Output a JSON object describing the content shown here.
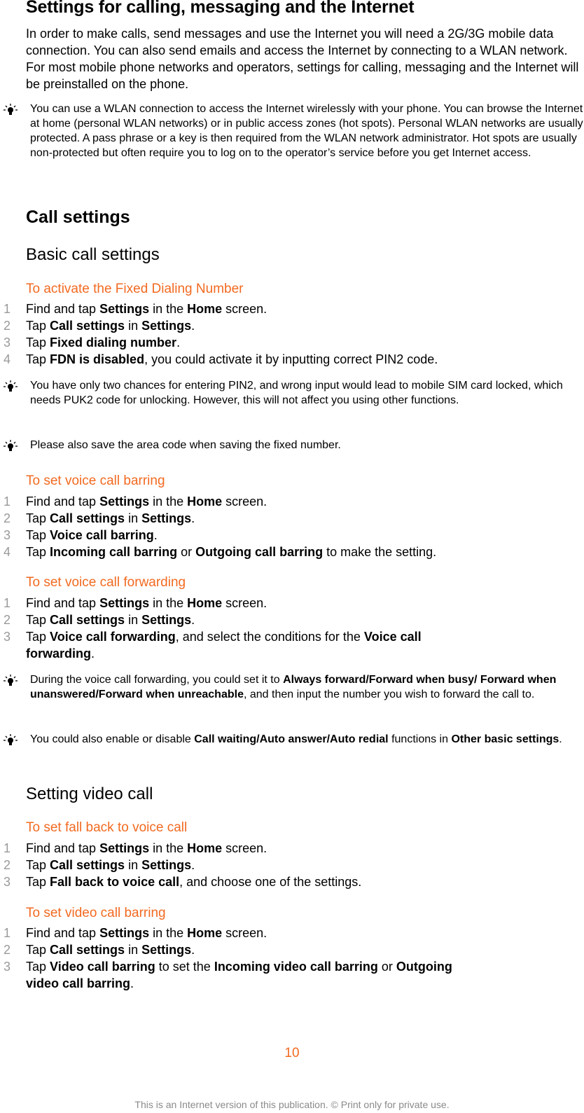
{
  "title": "Settings for calling, messaging and the Internet",
  "intro": "In order to make calls, send messages and use the Internet you will need a 2G/3G mobile data connection. You can also send emails and access the Internet by connecting to a WLAN network. For most mobile phone networks and operators, settings for calling, messaging and the Internet will be preinstalled on the phone.",
  "tips": {
    "wlan": "You can use a WLAN connection to access the Internet wirelessly with your phone. You can browse the Internet at home (personal WLAN networks) or in public access zones (hot spots). Personal WLAN networks are usually protected. A pass phrase or a key is then required from the WLAN network administrator. Hot spots are usually non-protected but often require you to log on to the operator’s service before you get Internet access.",
    "pin2": "You have only two chances for entering PIN2, and wrong input would lead to mobile SIM card locked, which needs PUK2 code for unlocking. However, this will not affect you using other functions.",
    "area_code": "Please also save the area code when saving the fixed number.",
    "forwarding": {
      "pre": "During the voice call forwarding, you could set it to ",
      "bold": "Always forward/Forward when busy/ Forward when unanswered/Forward when unreachable",
      "post": ", and then input the number you wish to forward the call to."
    },
    "other": {
      "pre": "You could also enable or disable ",
      "bold1": "Call waiting/Auto answer/Auto redial",
      "mid": " functions in ",
      "bold2": "Other basic settings",
      "post": "."
    }
  },
  "icons": {
    "tip": "lightbulb-icon"
  },
  "sections": {
    "call_settings": "Call settings",
    "basic": "Basic call settings",
    "video": "Setting video call"
  },
  "procedures": {
    "fdn": {
      "title": "To activate the Fixed Dialing Number",
      "steps": [
        {
          "n": "1",
          "a": "Find and tap ",
          "b": "Settings",
          "c": " in the ",
          "d": "Home",
          "e": " screen."
        },
        {
          "n": "2",
          "a": "Tap ",
          "b": "Call settings",
          "c": " in ",
          "d": "Settings",
          "e": "."
        },
        {
          "n": "3",
          "a": "Tap ",
          "b": "Fixed dialing number",
          "c": ".",
          "d": "",
          "e": ""
        },
        {
          "n": "4",
          "a": "Tap ",
          "b": "FDN is disabled",
          "c": ", you could activate it by inputting correct PIN2 code.",
          "d": "",
          "e": ""
        }
      ]
    },
    "voice_barring": {
      "title": "To set voice call barring",
      "steps": [
        {
          "n": "1",
          "a": "Find and tap ",
          "b": "Settings",
          "c": " in the ",
          "d": "Home",
          "e": " screen."
        },
        {
          "n": "2",
          "a": "Tap ",
          "b": "Call settings",
          "c": " in ",
          "d": "Settings",
          "e": "."
        },
        {
          "n": "3",
          "a": "Tap ",
          "b": "Voice call barring",
          "c": ".",
          "d": "",
          "e": ""
        },
        {
          "n": "4",
          "a": "Tap ",
          "b": "Incoming call barring",
          "c": " or ",
          "d": "Outgoing call barring",
          "e": " to make the setting."
        }
      ]
    },
    "voice_forwarding": {
      "title": "To set voice call forwarding",
      "steps": [
        {
          "n": "1",
          "a": "Find and tap ",
          "b": "Settings",
          "c": " in the ",
          "d": "Home",
          "e": " screen."
        },
        {
          "n": "2",
          "a": "Tap ",
          "b": "Call settings",
          "c": " in ",
          "d": "Settings",
          "e": "."
        },
        {
          "n": "3",
          "a": "Tap ",
          "b": "Voice call forwarding",
          "c": ", and select the conditions for the ",
          "d": "Voice call forwarding",
          "e": "."
        }
      ]
    },
    "fall_back": {
      "title": "To set fall back to voice call",
      "steps": [
        {
          "n": "1",
          "a": "Find and tap ",
          "b": "Settings",
          "c": " in the ",
          "d": "Home",
          "e": " screen."
        },
        {
          "n": "2",
          "a": "Tap ",
          "b": "Call settings",
          "c": " in ",
          "d": "Settings",
          "e": "."
        },
        {
          "n": "3",
          "a": "Tap ",
          "b": "Fall back to voice call",
          "c": ", and choose one of the settings.",
          "d": "",
          "e": ""
        }
      ]
    },
    "video_barring": {
      "title": "To set video call barring",
      "steps": [
        {
          "n": "1",
          "a": "Find and tap ",
          "b": "Settings",
          "c": " in the ",
          "d": "Home",
          "e": " screen."
        },
        {
          "n": "2",
          "a": "Tap ",
          "b": "Call settings",
          "c": " in ",
          "d": "Settings",
          "e": "."
        },
        {
          "n": "3",
          "a": "Tap ",
          "b": "Video call barring",
          "c": " to set the ",
          "d": "Incoming video call barring",
          "e": " or ",
          "f": "Outgoing video call barring",
          "g": "."
        }
      ]
    }
  },
  "page_number": "10",
  "footer": "This is an Internet version of this publication. © Print only for private use.",
  "colors": {
    "accent": "#f26a21",
    "step_number": "#9a9a9a",
    "footer": "#8a8a8a"
  }
}
